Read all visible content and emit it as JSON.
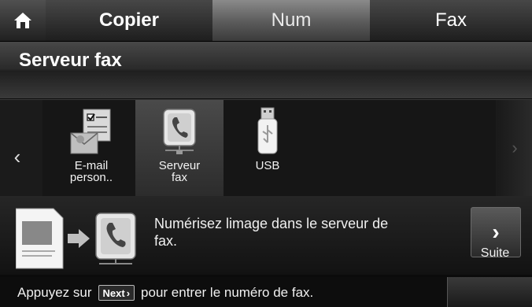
{
  "tabs": [
    {
      "label": "Copier"
    },
    {
      "label": "Num"
    },
    {
      "label": "Fax"
    }
  ],
  "title": "Serveur fax",
  "carousel": {
    "items": [
      {
        "label_line1": "E-mail",
        "label_line2": "person..",
        "icon": "personal-email-icon"
      },
      {
        "label_line1": "Serveur",
        "label_line2": "fax",
        "icon": "fax-server-icon"
      },
      {
        "label_line1": "USB",
        "label_line2": "",
        "icon": "usb-drive-icon"
      }
    ],
    "left_arrow": "‹",
    "right_arrow": "›"
  },
  "description": {
    "text_line1": "Numérisez limage dans le serveur de",
    "text_line2": "fax."
  },
  "next_button": {
    "symbol": "›",
    "label": "Suite"
  },
  "hint": {
    "before": "Appuyez sur",
    "key": "Next",
    "key_symbol": "›",
    "after": "pour entrer le numéro de fax."
  }
}
